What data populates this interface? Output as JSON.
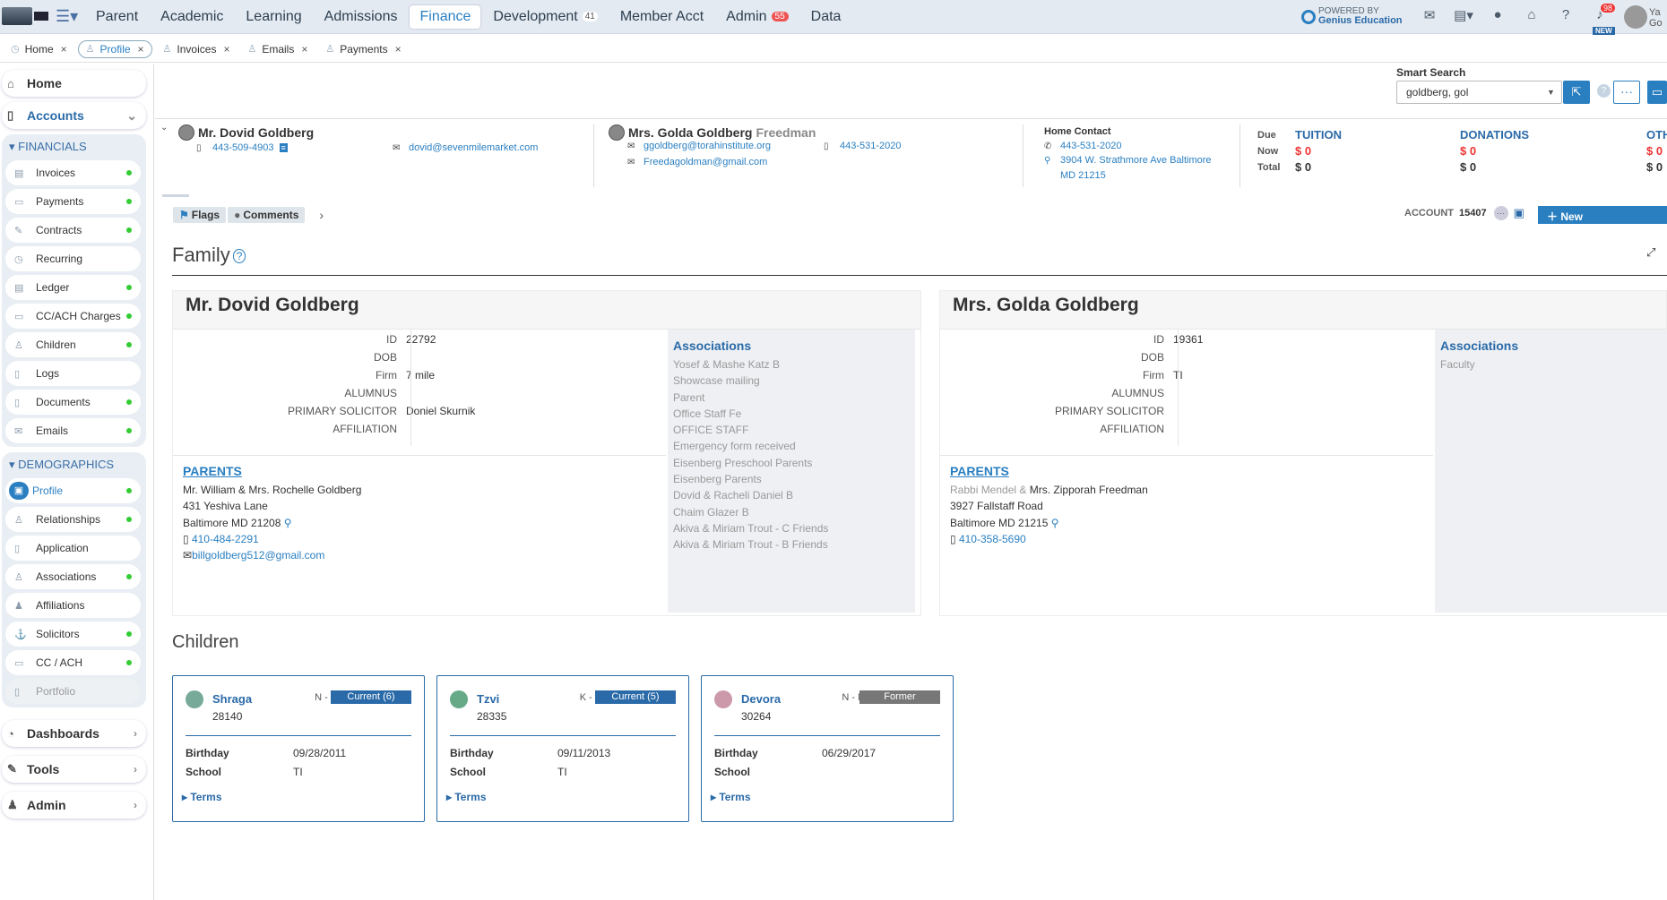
{
  "topbar": {
    "nav": [
      {
        "label": "Parent"
      },
      {
        "label": "Academic"
      },
      {
        "label": "Learning"
      },
      {
        "label": "Admissions"
      },
      {
        "label": "Finance",
        "active": true
      },
      {
        "label": "Development",
        "count": "41"
      },
      {
        "label": "Member Acct"
      },
      {
        "label": "Admin",
        "count": "55"
      },
      {
        "label": "Data"
      }
    ],
    "powered_line1": "POWERED BY",
    "powered_line2": "Genius Education",
    "bell_count": "98",
    "new_label": "NEW",
    "user_initials_1": "Ya",
    "user_initials_2": "Go"
  },
  "tabs": [
    {
      "label": "Home"
    },
    {
      "label": "Profile",
      "active": true
    },
    {
      "label": "Invoices"
    },
    {
      "label": "Emails"
    },
    {
      "label": "Payments"
    }
  ],
  "sidebar": {
    "home": "Home",
    "accounts": "Accounts",
    "financials_header": "FINANCIALS",
    "financials": [
      "Invoices",
      "Payments",
      "Contracts",
      "Recurring",
      "Ledger",
      "CC/ACH Charges",
      "Children",
      "Logs",
      "Documents",
      "Emails"
    ],
    "demographics_header": "DEMOGRAPHICS",
    "demographics": [
      "Profile",
      "Relationships",
      "Application",
      "Associations",
      "Affiliations",
      "Solicitors",
      "CC / ACH",
      "Portfolio"
    ],
    "dashboards": "Dashboards",
    "tools": "Tools",
    "admin": "Admin"
  },
  "smart_search": {
    "label": "Smart Search",
    "value": "goldberg, gol"
  },
  "contact": {
    "p1_name": "Mr. Dovid Goldberg",
    "p1_phone": "443-509-4903",
    "p1_email": "dovid@sevenmilemarket.com",
    "p2_name": "Mrs. Golda Goldberg",
    "p2_maiden": "Freedman",
    "p2_email1": "ggoldberg@torahinstitute.org",
    "p2_phone": "443-531-2020",
    "p2_email2": "Freedagoldman@gmail.com",
    "home_label": "Home Contact",
    "home_phone": "443-531-2020",
    "home_addr1": "3904 W. Strathmore Ave Baltimore",
    "home_addr2": "MD 21215"
  },
  "summary": {
    "row_labels": [
      "Due",
      "Now",
      "Total"
    ],
    "columns": [
      {
        "title": "TUITION",
        "now": "$ 0",
        "total": "$ 0"
      },
      {
        "title": "DONATIONS",
        "now": "$ 0",
        "total": "$ 0"
      },
      {
        "title": "OTH",
        "now": "$ 0",
        "total": "$ 0"
      }
    ]
  },
  "flags_label": "Flags",
  "comments_label": "Comments",
  "account_label": "ACCOUNT",
  "account_number": "15407",
  "new_button": "New",
  "family_title": "Family",
  "family": [
    {
      "name": "Mr. Dovid Goldberg",
      "fields": [
        {
          "k": "ID",
          "v": "22792"
        },
        {
          "k": "DOB",
          "v": ""
        },
        {
          "k": "Firm",
          "v": "7 mile"
        },
        {
          "k": "ALUMNUS",
          "v": ""
        },
        {
          "k": "PRIMARY SOLICITOR",
          "v": "Doniel Skurnik"
        },
        {
          "k": "AFFILIATION",
          "v": ""
        }
      ],
      "assoc_title": "Associations",
      "associations": [
        "Yosef & Mashe Katz B",
        "Showcase mailing",
        "Parent",
        "Office Staff Fe",
        "OFFICE STAFF",
        "Emergency form received",
        "Eisenberg Preschool Parents",
        "Eisenberg Parents",
        "Dovid & Racheli Daniel B",
        "Chaim Glazer B",
        "Akiva & Miriam Trout - C Friends",
        "Akiva & Miriam Trout - B Friends"
      ],
      "parents_title": "PARENTS",
      "parents_names": "Mr. William & Mrs. Rochelle Goldberg",
      "parents_street": "431 Yeshiva Lane",
      "parents_city": "Baltimore MD 21208",
      "parents_phone": "410-484-2291",
      "parents_email": "billgoldberg512@gmail.com"
    },
    {
      "name": "Mrs. Golda Goldberg",
      "fields": [
        {
          "k": "ID",
          "v": "19361"
        },
        {
          "k": "DOB",
          "v": ""
        },
        {
          "k": "Firm",
          "v": "TI"
        },
        {
          "k": "ALUMNUS",
          "v": ""
        },
        {
          "k": "PRIMARY SOLICITOR",
          "v": ""
        },
        {
          "k": "AFFILIATION",
          "v": ""
        }
      ],
      "assoc_title": "Associations",
      "associations": [
        "Faculty"
      ],
      "parents_title": "PARENTS",
      "parents_names_grey": "Rabbi Mendel &",
      "parents_names": "Mrs. Zipporah Freedman",
      "parents_street": "3927 Fallstaff Road",
      "parents_city": "Baltimore MD 21215",
      "parents_phone": "410-358-5690"
    }
  ],
  "children_title": "Children",
  "children": [
    {
      "name": "Shraga",
      "id": "28140",
      "grade": "N - 7",
      "status": "Current  (6)",
      "birthday_label": "Birthday",
      "birthday": "09/28/2011",
      "school_label": "School",
      "school": "TI",
      "terms": "Terms"
    },
    {
      "name": "Tzvi",
      "id": "28335",
      "grade": "K - 6",
      "status": "Current  (5)",
      "birthday_label": "Birthday",
      "birthday": "09/11/2013",
      "school_label": "School",
      "school": "TI",
      "terms": "Terms"
    },
    {
      "name": "Devora",
      "id": "30264",
      "grade": "N - N",
      "status": "Former",
      "birthday_label": "Birthday",
      "birthday": "06/29/2017",
      "school_label": "School",
      "school": "",
      "terms": "Terms"
    }
  ]
}
